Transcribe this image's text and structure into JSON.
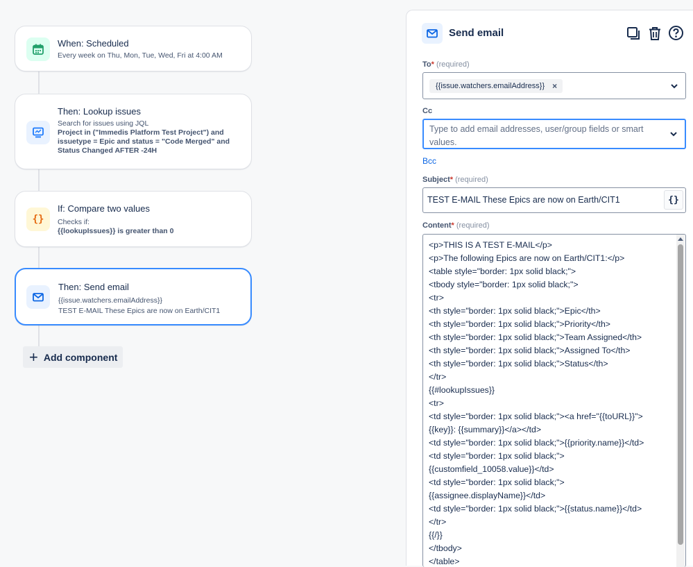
{
  "flow": {
    "trigger": {
      "title": "When: Scheduled",
      "subtitle": "Every week on Thu, Mon, Tue, Wed, Fri at 4:00 AM",
      "icon": "calendar-icon",
      "color": "#22a06b"
    },
    "lookup": {
      "title": "Then: Lookup issues",
      "subtitle": "Search for issues using JQL",
      "jql_lines": [
        "Project in (\"Immedis Platform Test Project\") and",
        "issuetype = Epic and status = \"Code Merged\" and",
        "Status Changed AFTER -24H"
      ],
      "icon": "monitor-icon",
      "color": "#1d7afc"
    },
    "condition": {
      "title": "If: Compare two values",
      "subtitle": "Checks if:",
      "expression": "{{lookupIssues}} is greater than 0",
      "icon": "braces-icon",
      "color": "#e56910"
    },
    "action": {
      "title": "Then: Send email",
      "line1": "{{issue.watchers.emailAddress}}",
      "line2": "TEST E-MAIL These Epics are now on Earth/CIT1",
      "icon": "mail-icon",
      "color": "#0c66e4"
    },
    "add_component_label": "Add component"
  },
  "panel": {
    "title": "Send email",
    "to": {
      "label": "To",
      "required_mark": "*",
      "hint": "(required)",
      "chip": "{{issue.watchers.emailAddress}}",
      "chip_remove": "×"
    },
    "cc": {
      "label": "Cc",
      "placeholder_line1": "Type to add email addresses, user/group fields or smart",
      "placeholder_line2": "values."
    },
    "bcc_link": "Bcc",
    "subject": {
      "label": "Subject",
      "required_mark": "*",
      "hint": "(required)",
      "value": "TEST E-MAIL These Epics are now on Earth/CIT1",
      "smart_value_button": "{}"
    },
    "content": {
      "label": "Content",
      "required_mark": "*",
      "hint": "(required)",
      "lines": [
        "<p>THIS IS A TEST E-MAIL</p>",
        "<p>The following Epics are now on Earth/CIT1:</p>",
        "<table style=\"border: 1px solid black;\">",
        "<tbody style=\"border: 1px solid black;\">",
        "<tr>",
        "<th style=\"border: 1px solid black;\">Epic</th>",
        "<th style=\"border: 1px solid black;\">Priority</th>",
        "<th style=\"border: 1px solid black;\">Team Assigned</th>",
        "<th style=\"border: 1px solid black;\">Assigned To</th>",
        "<th style=\"border: 1px solid black;\">Status</th>",
        "</tr>",
        "{{#lookupIssues}}",
        "<tr>",
        "<td style=\"border: 1px solid black;\"><a href=\"{{toURL}}\">",
        "{{key}}: {{summary}}</a></td>",
        "<td style=\"border: 1px solid black;\">{{priority.name}}</td>",
        "<td style=\"border: 1px solid black;\">",
        "{{customfield_10058.value}}</td>",
        "<td style=\"border: 1px solid black;\">",
        "{{assignee.displayName}}</td>",
        "<td style=\"border: 1px solid black;\">{{status.name}}</td>",
        "</tr>",
        "{{/}}",
        "</tbody>",
        "</table>"
      ]
    },
    "header_icons": [
      "duplicate-icon",
      "trash-icon",
      "help-icon"
    ]
  }
}
